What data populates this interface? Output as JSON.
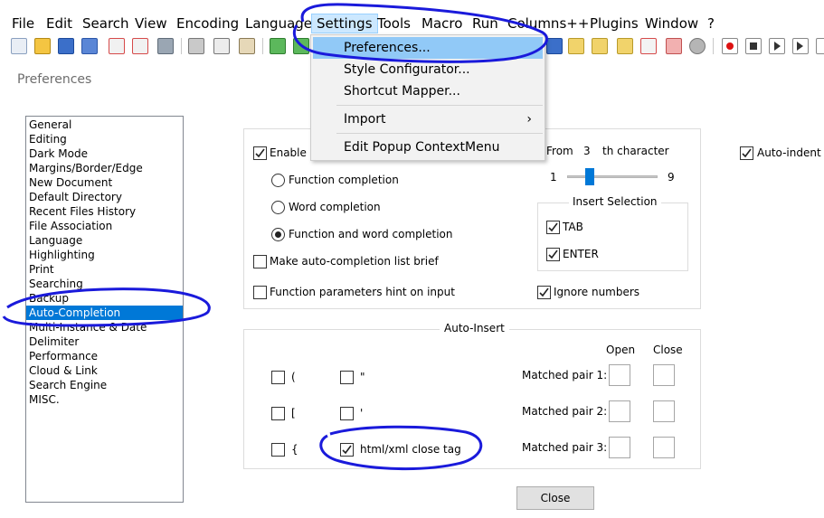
{
  "menubar": [
    "File",
    "Edit",
    "Search",
    "View",
    "Encoding",
    "Language",
    "Settings",
    "Tools",
    "Macro",
    "Run",
    "Columns++",
    "Plugins",
    "Window",
    "?"
  ],
  "settings_menu": {
    "items": [
      "Preferences...",
      "Style Configurator...",
      "Shortcut Mapper...",
      "Import",
      "Edit Popup ContextMenu"
    ],
    "submenu_arrow": "›"
  },
  "dialog": {
    "title": "Preferences",
    "categories": [
      "General",
      "Editing",
      "Dark Mode",
      "Margins/Border/Edge",
      "New Document",
      "Default Directory",
      "Recent Files History",
      "File Association",
      "Language",
      "Highlighting",
      "Print",
      "Searching",
      "Backup",
      "Auto-Completion",
      "Multi-Instance & Date",
      "Delimiter",
      "Performance",
      "Cloud & Link",
      "Search Engine",
      "MISC."
    ],
    "selected_category": "Auto-Completion",
    "autocompletion": {
      "enable_label": "Enable auto-completion on each input",
      "enable_visible": "Enable a",
      "radio_function": "Function completion",
      "radio_word": "Word completion",
      "radio_both": "Function and word completion",
      "make_brief": "Make auto-completion list brief",
      "param_hint": "Function parameters hint on input",
      "from_label": "From",
      "from_value": "3",
      "th_char": "th character",
      "slider_min": "1",
      "slider_max": "9",
      "slider_value": 3,
      "insert_selection_title": "Insert Selection",
      "tab_label": "TAB",
      "enter_label": "ENTER",
      "ignore_numbers": "Ignore numbers",
      "auto_indent": "Auto-indent"
    },
    "auto_insert": {
      "title": "Auto-Insert",
      "open_header": "Open",
      "close_header": "Close",
      "paren": "(",
      "bracket": "[",
      "brace": "{",
      "dquote": "\"",
      "squote": "'",
      "html_close_tag": "html/xml close tag",
      "pair1": "Matched pair 1:",
      "pair2": "Matched pair 2:",
      "pair3": "Matched pair 3:"
    },
    "close_button": "Close"
  },
  "colors": {
    "accent": "#0078d7",
    "annotation": "#1a1adb",
    "menu_highlight": "#91c9f7"
  }
}
